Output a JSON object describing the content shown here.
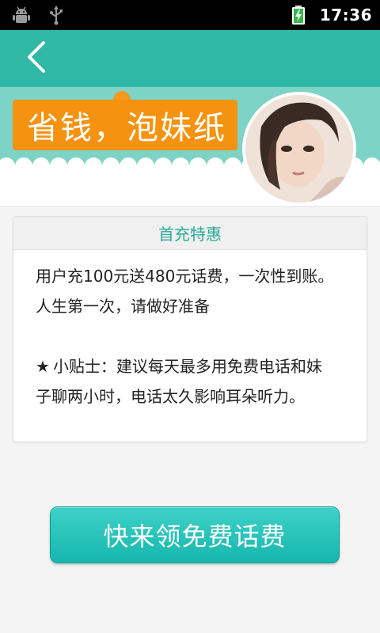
{
  "status_bar": {
    "time": "17:36",
    "icons": [
      "android-debug-icon",
      "usb-icon",
      "battery-charging-icon"
    ]
  },
  "header": {
    "back_icon": "chevron-left-icon"
  },
  "banner": {
    "slogan": "省钱，泡妹纸",
    "colors": {
      "title_bar": "#2fb8a4",
      "banner": "#7dd3c6",
      "slogan_bg": "#f5920f"
    }
  },
  "card": {
    "title": "首充特惠",
    "line1": "用户充100元送480元话费，一次性到账。",
    "line2": "人生第一次，请做好准备",
    "tip_label": "小贴士：",
    "tip_text_1": "建议每天最多用免费电话和妹",
    "tip_text_2": "子聊两小时，电话太久影响耳朵听力。"
  },
  "cta": {
    "label": "快来领免费话费",
    "color": "#1fbfb4"
  }
}
